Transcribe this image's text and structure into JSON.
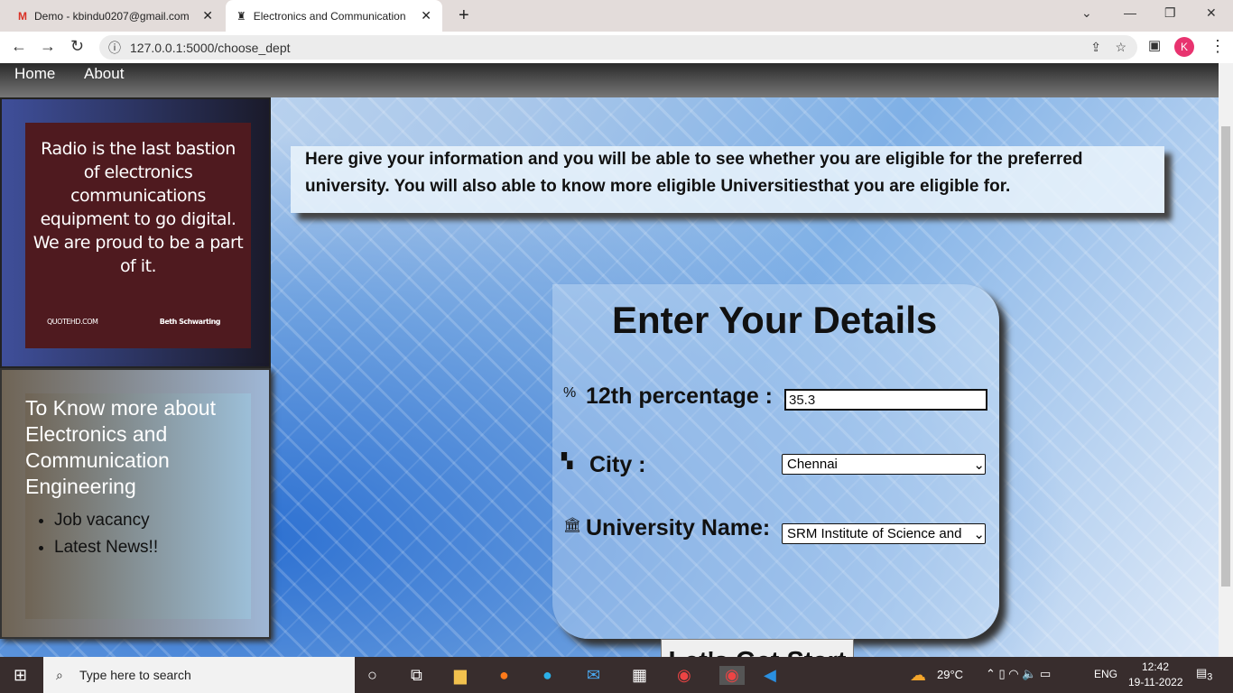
{
  "browser": {
    "tabs": [
      {
        "label": "Demo - kbindu0207@gmail.com"
      },
      {
        "label": "Electronics and Communication E"
      }
    ],
    "url": "127.0.0.1:5000/choose_dept",
    "profile_initial": "K"
  },
  "nav": {
    "items": [
      "Home",
      "About"
    ]
  },
  "quote": {
    "text": "Radio is the last bastion of electronics communications equipment to go digital. We are proud to be a part of it.",
    "source": "QUOTEHD.COM",
    "author": "Beth Schwarting"
  },
  "info": {
    "title": "To Know more about Electronics and Communication Engineering",
    "links": [
      "Job vacancy",
      "Latest News!!"
    ]
  },
  "banner": "Here give your information and you will be able to see whether you are eligible for the preferred university. You will also able to know more eligible Universitiesthat you are eligible for.",
  "form": {
    "title": "Enter Your Details",
    "percentage_label": "12th percentage :",
    "percentage_value": "35.3",
    "city_label": "City :",
    "city_value": "Chennai",
    "university_label": "University Name:",
    "university_value": "SRM Institute of Science and",
    "submit": "Let's Get Start"
  },
  "taskbar": {
    "search_placeholder": "Type here to search",
    "weather": "29°C",
    "lang": "ENG",
    "time": "12:42",
    "date": "19-11-2022",
    "notifications": "3"
  }
}
